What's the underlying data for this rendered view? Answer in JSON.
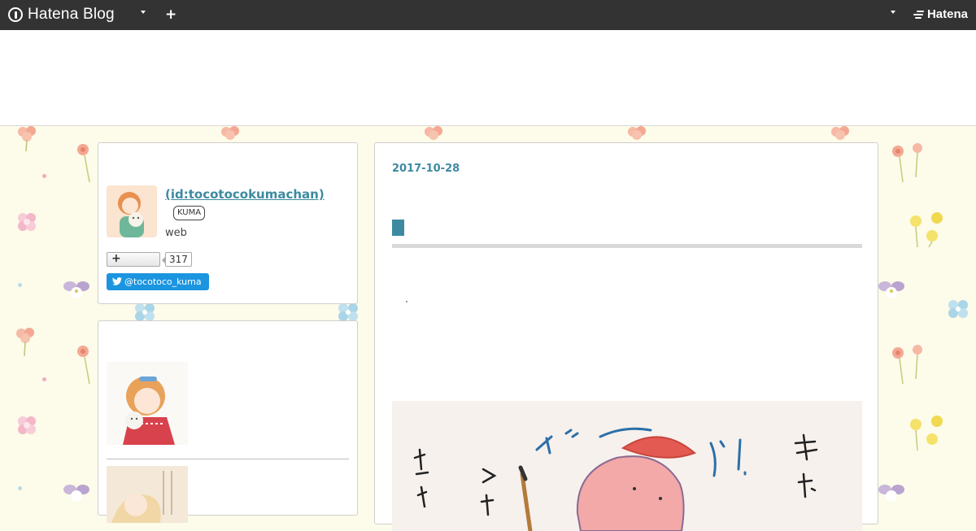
{
  "topbar": {
    "logo_text": "Hatena Blog",
    "plus_label": "+",
    "brand_text": "Hatena",
    "icons": [
      "hatena-blog-logo-icon",
      "chevron-down-icon",
      "plus-icon",
      "hatena-mark-icon"
    ]
  },
  "profile": {
    "link_text": " (id:tocotocokumachan)",
    "badge": "KUMA",
    "description": "web",
    "follow_plus": "+",
    "follower_count": "317",
    "twitter_handle": "@tocotoco_kuma"
  },
  "article": {
    "date": "2017-10-28"
  },
  "colors": {
    "topbar": "#333333",
    "accent": "#3d8aa0",
    "background": "#fdfbe9",
    "twitter": "#1b95e0"
  }
}
